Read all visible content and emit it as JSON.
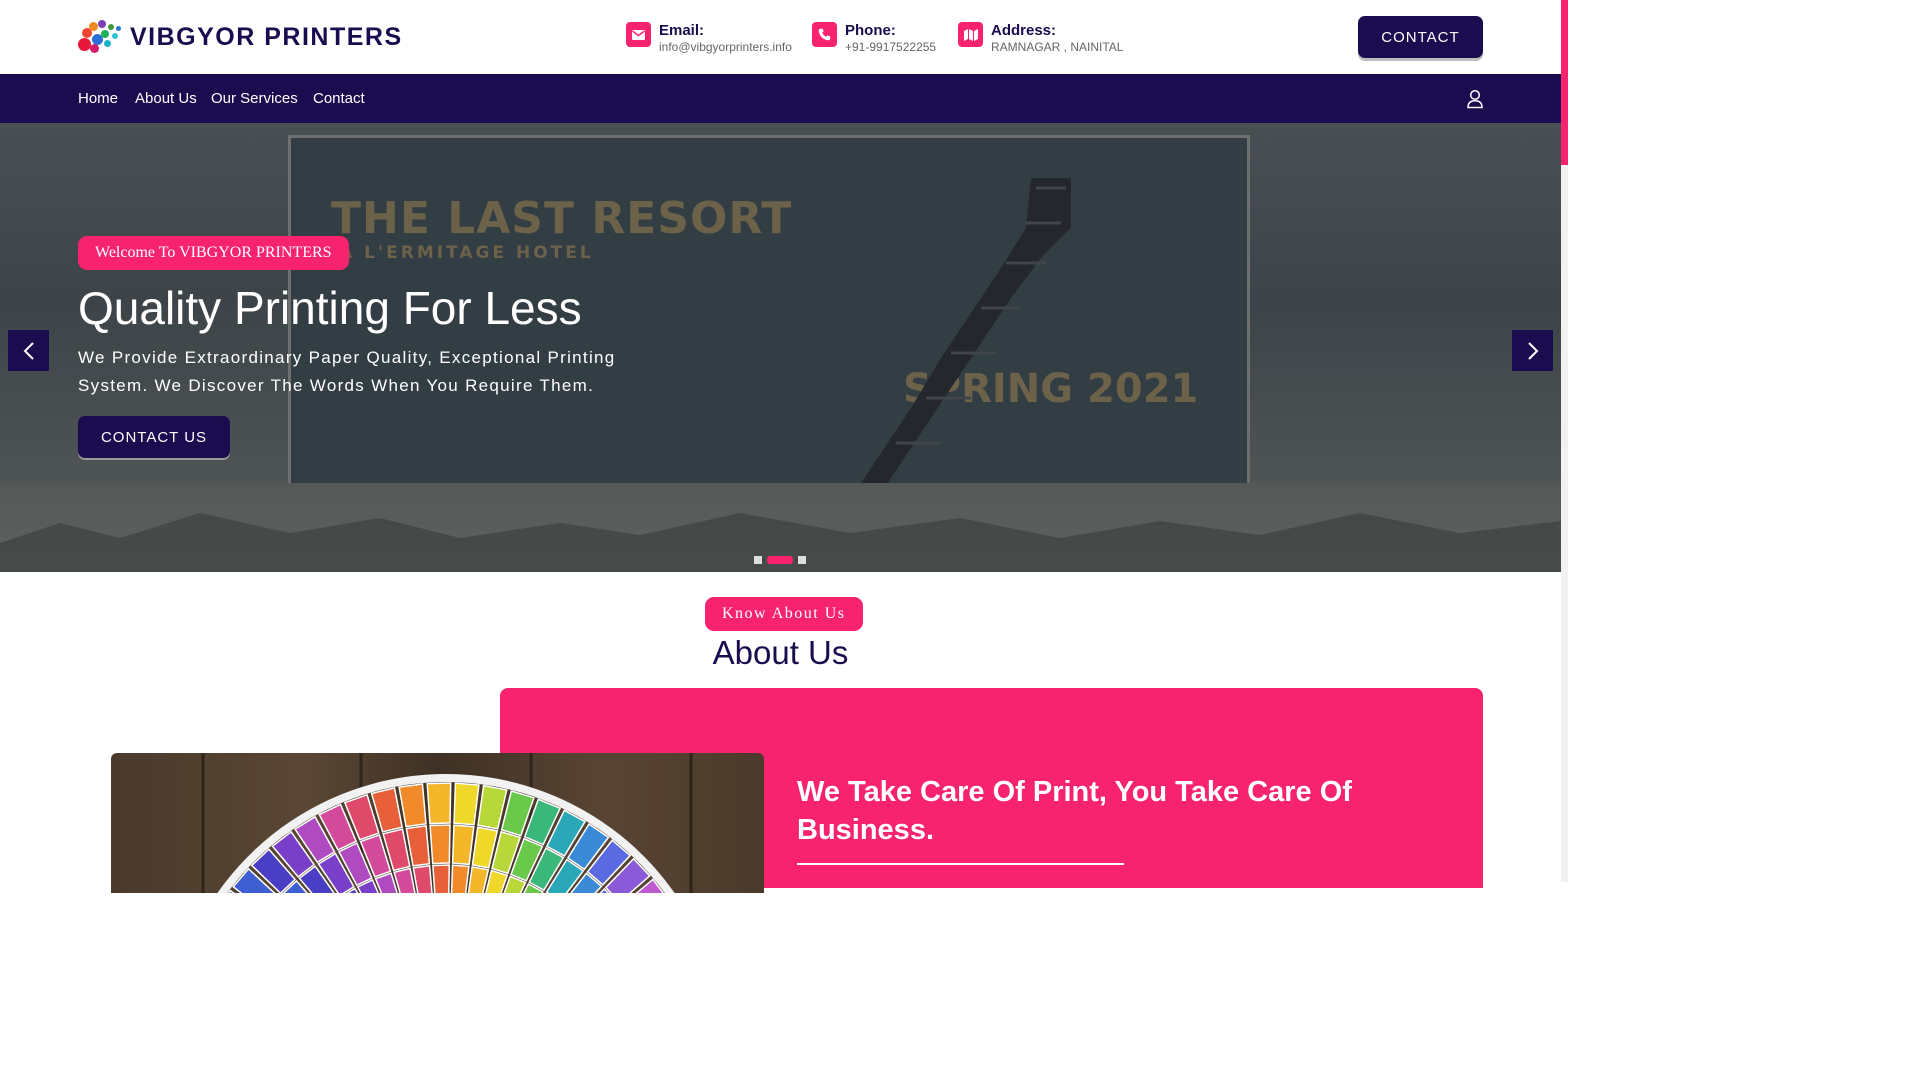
{
  "brand": {
    "name": "VIBGYOR PRINTERS",
    "primary_color": "#1b0b4f",
    "accent_color": "#f7236f"
  },
  "header": {
    "email": {
      "label": "Email:",
      "value": "info@vibgyorprinters.info",
      "icon": "envelope-icon"
    },
    "phone": {
      "label": "Phone:",
      "value": "+91-9917522255",
      "icon": "phone-icon"
    },
    "address": {
      "label": "Address:",
      "value": "RAMNAGAR , NAINITAL",
      "icon": "map-icon"
    },
    "contact_button": "CONTACT"
  },
  "nav": {
    "items": [
      {
        "label": "Home"
      },
      {
        "label": "About Us"
      },
      {
        "label": "Our Services"
      },
      {
        "label": "Contact"
      }
    ],
    "account_icon": "user-icon"
  },
  "hero": {
    "tagline": "Welcome To VIBGYOR PRINTERS",
    "title": "Quality Printing For Less",
    "description": "We Provide Extraordinary Paper Quality, Exceptional Printing System. We Discover The Words When You Require Them.",
    "button": "CONTACT US",
    "billboard": {
      "title": "THE LAST RESORT",
      "subtitle": "A L'ERMITAGE HOTEL",
      "season": "SPRING 2021"
    },
    "slides_total": 3,
    "active_slide": 2
  },
  "about": {
    "tagline": "Know About Us",
    "title": "About Us",
    "heading": "We Take Care Of Print, You Take Care Of Business."
  }
}
